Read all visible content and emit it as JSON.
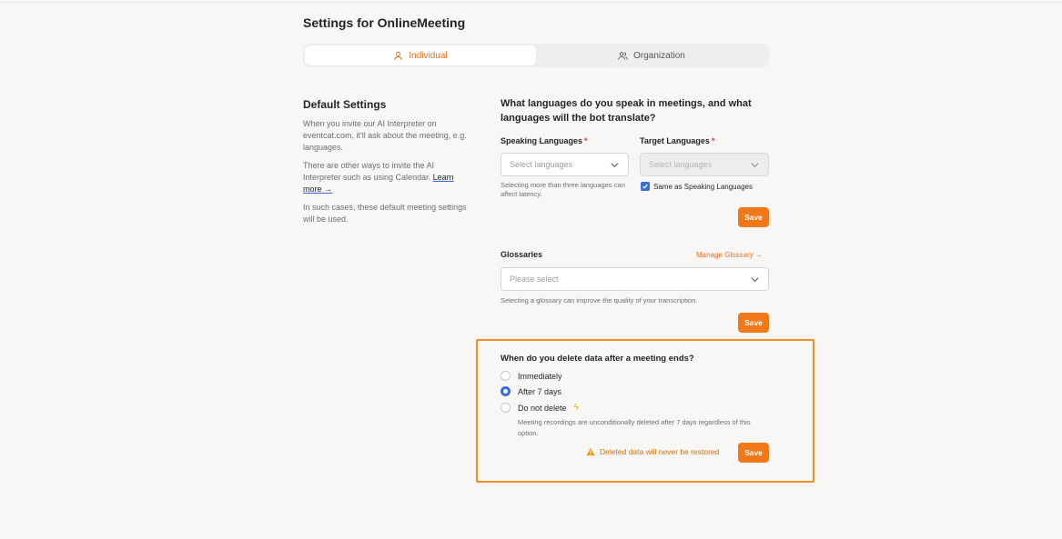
{
  "page": {
    "title": "Settings for OnlineMeeting"
  },
  "tabs": [
    {
      "label": "Individual",
      "icon": "user-icon",
      "active": true
    },
    {
      "label": "Organization",
      "icon": "users-icon",
      "active": false
    }
  ],
  "default_settings": {
    "title": "Default Settings",
    "paragraph1": "When you invite our AI Interpreter on eventcat.com, it'll ask about the meeting, e.g. languages.",
    "paragraph2_prefix": "There are other ways to invite the AI Interpreter such as using Calendar.",
    "learn_more": "Learn more",
    "paragraph3": "In such cases, these default meeting settings will be used."
  },
  "languages": {
    "question": "What languages do you speak in meetings, and what languages will the bot translate?",
    "speaking_label": "Speaking Languages",
    "target_label": "Target Languages",
    "required_mark": "*",
    "speaking_placeholder": "Select languages",
    "target_placeholder": "Select languages",
    "speaking_hint": "Selecting more than three languages can affect latency.",
    "same_as_label": "Same as Speaking Languages",
    "same_as_checked": true,
    "save_label": "Save"
  },
  "glossaries": {
    "label": "Glossaries",
    "manage_link": "Manage Glossary",
    "placeholder": "Please select",
    "hint": "Selecting a glossary can improve the quality of your transcription.",
    "save_label": "Save"
  },
  "data_deletion": {
    "question": "When do you delete data after a meeting ends?",
    "options": [
      {
        "label": "Immediately",
        "checked": false
      },
      {
        "label": "After 7 days",
        "checked": true
      },
      {
        "label": "Do not delete",
        "checked": false
      }
    ],
    "note": "Meeting recordings are unconditionally deleted after 7 days regardless of this option.",
    "warning": "Deleted data will never be restored",
    "save_label": "Save"
  },
  "colors": {
    "accent": "#f07818",
    "link": "#e6711b",
    "radio_checked": "#3a6cd9",
    "highlight_border": "#f0901f",
    "warning_text": "#c7740f"
  }
}
